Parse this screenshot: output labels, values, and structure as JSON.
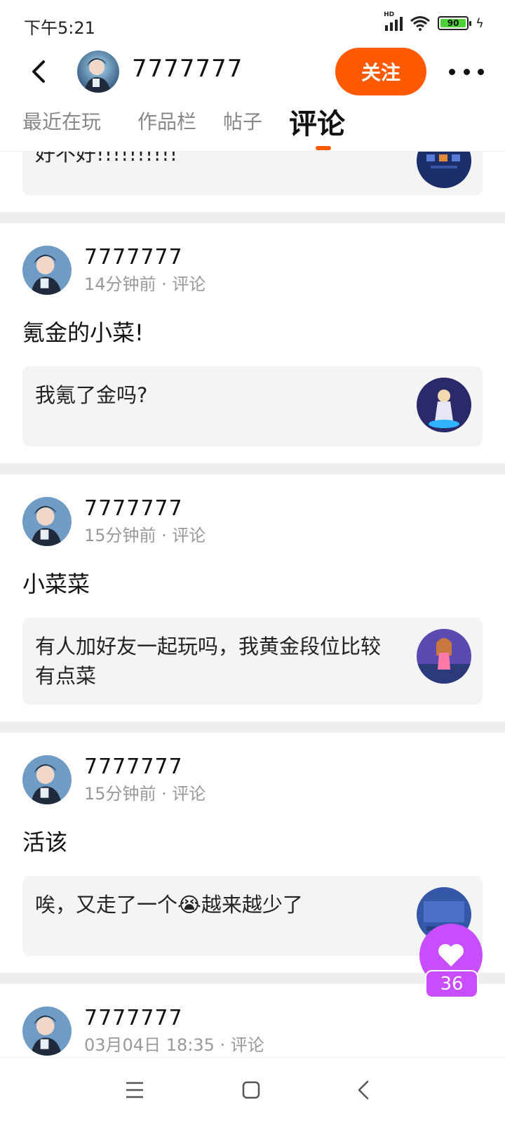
{
  "status_bar": {
    "time": "下午5:21",
    "network_badge": "HD",
    "battery_level": "90",
    "icons": [
      "signal-icon",
      "wifi-icon",
      "battery-icon",
      "charging-icon"
    ]
  },
  "header": {
    "user_name": "7777777",
    "follow_label": "关注",
    "icons": [
      "back-arrow-icon",
      "more-dots-icon"
    ]
  },
  "tabs": [
    {
      "label": "最近在玩",
      "active": false
    },
    {
      "label": "作品栏",
      "active": false
    },
    {
      "label": "帖子",
      "active": false
    },
    {
      "label": "评论",
      "active": true
    }
  ],
  "top_partial": {
    "quote_text": "好不好!!!!!!!!!!"
  },
  "feed": [
    {
      "user_name": "7777777",
      "meta": "14分钟前 · 评论",
      "comment": "氪金的小菜!",
      "quote": "我氪了金吗?"
    },
    {
      "user_name": "7777777",
      "meta": "15分钟前 · 评论",
      "comment": "小菜菜",
      "quote": "有人加好友一起玩吗，我黄金段位比较有点菜"
    },
    {
      "user_name": "7777777",
      "meta": "15分钟前 · 评论",
      "comment": "活该",
      "quote": "唉，又走了一个😭越来越少了"
    },
    {
      "user_name": "7777777",
      "meta": "03月04日 18:35 · 评论",
      "comment": "",
      "quote": ""
    }
  ],
  "like": {
    "count": "36",
    "color": "#c84dff"
  },
  "colors": {
    "accent": "#ff5a00",
    "like": "#c84dff",
    "divider": "#eeeeee",
    "quote_bg": "#f4f4f4"
  },
  "nav": {
    "icons": [
      "menu-icon",
      "home-icon",
      "back-icon"
    ]
  }
}
